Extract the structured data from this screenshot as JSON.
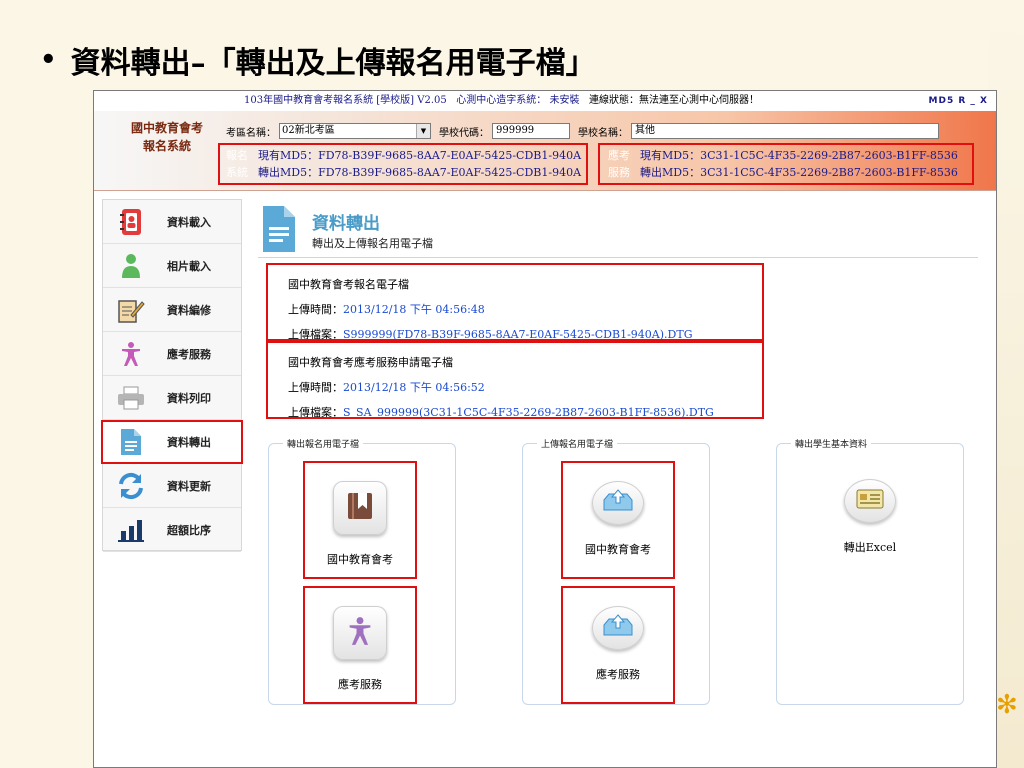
{
  "slide": {
    "bullet": "•",
    "title": "資料轉出–「轉出及上傳報名用電子檔」"
  },
  "titlebar": {
    "system": "103年國中教育會考報名系統 [學校版] V2.05",
    "center_label": "心測中心造字系統：",
    "center_value": "未安裝",
    "connection": "連線狀態：無法連至心測中心伺服器！",
    "right": "MD5  R      _   X"
  },
  "header": {
    "logo_line1": "國中教育會考",
    "logo_line2": "報名系統",
    "district_label": "考區名稱：",
    "district_value": "02新北考區",
    "school_code_label": "學校代碼：",
    "school_code_value": "999999",
    "school_name_label": "學校名稱：",
    "school_name_value": "其他",
    "reg_tag1": "報名",
    "reg_tag2": "系統",
    "reg_current_md5": "現有MD5：FD78-B39F-9685-8AA7-E0AF-5425-CDB1-940A",
    "reg_export_md5": "轉出MD5：FD78-B39F-9685-8AA7-E0AF-5425-CDB1-940A",
    "svc_tag1": "應考",
    "svc_tag2": "服務",
    "svc_current_md5": "現有MD5：3C31-1C5C-4F35-2269-2B87-2603-B1FF-8536",
    "svc_export_md5": "轉出MD5：3C31-1C5C-4F35-2269-2B87-2603-B1FF-8536"
  },
  "sidebar": {
    "items": [
      {
        "label": "資料載入",
        "icon": "address-book-icon"
      },
      {
        "label": "相片載入",
        "icon": "person-icon"
      },
      {
        "label": "資料編修",
        "icon": "edit-document-icon"
      },
      {
        "label": "應考服務",
        "icon": "accessibility-icon"
      },
      {
        "label": "資料列印",
        "icon": "printer-icon"
      },
      {
        "label": "資料轉出",
        "icon": "document-icon"
      },
      {
        "label": "資料更新",
        "icon": "refresh-icon"
      },
      {
        "label": "超額比序",
        "icon": "bar-chart-icon"
      }
    ]
  },
  "main": {
    "title": "資料轉出",
    "subtitle": "轉出及上傳報名用電子檔",
    "records": [
      {
        "name": "國中教育會考報名電子檔",
        "time_label": "上傳時間：",
        "time_value": "2013/12/18 下午 04:56:48",
        "file_label": "上傳檔案：",
        "file_value": "S999999(FD78-B39F-9685-8AA7-E0AF-5425-CDB1-940A).DTG"
      },
      {
        "name": "國中教育會考應考服務申請電子檔",
        "time_label": "上傳時間：",
        "time_value": "2013/12/18 下午 04:56:52",
        "file_label": "上傳檔案：",
        "file_value": "S_SA_999999(3C31-1C5C-4F35-2269-2B87-2603-B1FF-8536).DTG"
      }
    ],
    "groups": [
      {
        "label": "轉出報名用電子檔",
        "buttons": [
          "國中教育會考",
          "應考服務"
        ]
      },
      {
        "label": "上傳報名用電子檔",
        "buttons": [
          "國中教育會考",
          "應考服務"
        ]
      },
      {
        "label": "轉出學生基本資料",
        "buttons": [
          "轉出Excel"
        ]
      }
    ]
  }
}
